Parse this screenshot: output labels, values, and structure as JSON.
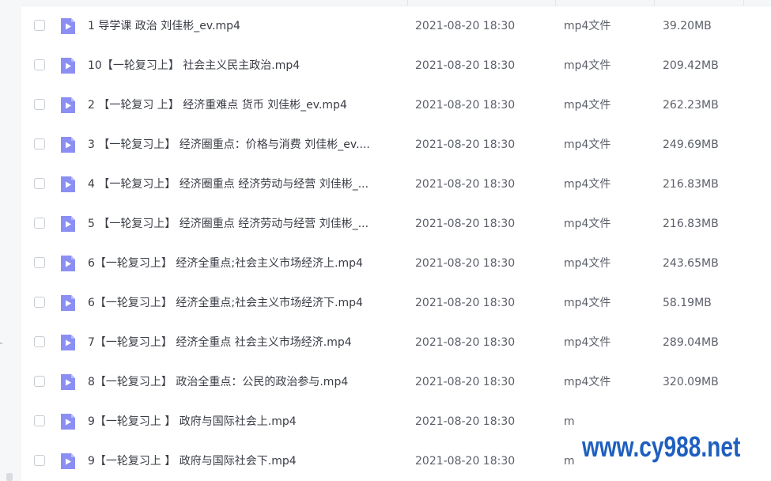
{
  "files": [
    {
      "name": "1  导学课   政治 刘佳彬_ev.mp4",
      "date": "2021-08-20 18:30",
      "type": "mp4文件",
      "size": "39.20MB"
    },
    {
      "name": "10【一轮复习上】  社会主义民主政治.mp4",
      "date": "2021-08-20 18:30",
      "type": "mp4文件",
      "size": "209.42MB"
    },
    {
      "name": "2 【一轮复习 上】 经济重难点  货币   刘佳彬_ev.mp4",
      "date": "2021-08-20 18:30",
      "type": "mp4文件",
      "size": "262.23MB"
    },
    {
      "name": "3 【一轮复习上】 经济圈重点：价格与消费  刘佳彬_ev....",
      "date": "2021-08-20 18:30",
      "type": "mp4文件",
      "size": "249.69MB"
    },
    {
      "name": "4 【一轮复习上】  经济圈重点 经济劳动与经营   刘佳彬_...",
      "date": "2021-08-20 18:30",
      "type": "mp4文件",
      "size": "216.83MB"
    },
    {
      "name": "5 【一轮复习上】  经济圈重点 经济劳动与经营   刘佳彬_...",
      "date": "2021-08-20 18:30",
      "type": "mp4文件",
      "size": "216.83MB"
    },
    {
      "name": "6【一轮复习上】 经济全重点;社会主义市场经济上.mp4",
      "date": "2021-08-20 18:30",
      "type": "mp4文件",
      "size": "243.65MB"
    },
    {
      "name": "6【一轮复习上】 经济全重点;社会主义市场经济下.mp4",
      "date": "2021-08-20 18:30",
      "type": "mp4文件",
      "size": "58.19MB"
    },
    {
      "name": "7【一轮复习上】 经济全重点  社会主义市场经济.mp4",
      "date": "2021-08-20 18:30",
      "type": "mp4文件",
      "size": "289.04MB"
    },
    {
      "name": "8【一轮复习上】 政治全重点：公民的政治参与.mp4",
      "date": "2021-08-20 18:30",
      "type": "mp4文件",
      "size": "320.09MB"
    },
    {
      "name": "9【一轮复习上 】  政府与国际社会上.mp4",
      "date": "2021-08-20 18:30",
      "type": "m",
      "size": ""
    },
    {
      "name": "9【一轮复习上 】  政府与国际社会下.mp4",
      "date": "2021-08-20 18:30",
      "type": "m",
      "size": ""
    }
  ],
  "watermark": "www.cy988.net",
  "icon": {
    "name": "video-file-icon",
    "color": "#8b8ff3"
  },
  "colors": {
    "accent": "#1f5fbf"
  }
}
